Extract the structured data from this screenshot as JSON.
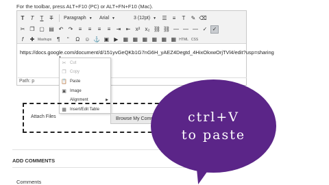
{
  "hint": "For the toolbar, press ALT+F10 (PC) or ALT+FN+F10 (Mac).",
  "toolbar": {
    "paragraph": "Paragraph",
    "font": "Arial",
    "size": "3 (12pt)",
    "mashups": "Mashups",
    "html": "HTML",
    "css": "CSS"
  },
  "editor_content": "https://docs.google.com/document/d/151yvGeQKb1G7nG6H_yAEZ4Degtd_4HixOkxwOrjTVl4/edit?usp=sharing",
  "path_label": "Path: p",
  "context_menu": {
    "items": [
      {
        "label": "Cut",
        "icon": "scissors-icon",
        "disabled": true
      },
      {
        "label": "Copy",
        "icon": "copy-icon",
        "disabled": true
      },
      {
        "label": "Paste",
        "icon": "paste-icon",
        "disabled": false
      },
      {
        "label": "Image",
        "icon": "image-icon",
        "disabled": false
      },
      {
        "label": "Alignment",
        "icon": "",
        "disabled": false,
        "submenu": true
      },
      {
        "label": "Insert/Edit Table",
        "icon": "table-icon",
        "disabled": false
      }
    ]
  },
  "attach": {
    "label": "Attach Files",
    "browse_button": "Browse My Compu"
  },
  "add_comments": "ADD COMMENTS",
  "comments": "Comments",
  "bubble": {
    "line1": "ctrl+V",
    "line2": "to paste",
    "color": "#5b2588"
  }
}
